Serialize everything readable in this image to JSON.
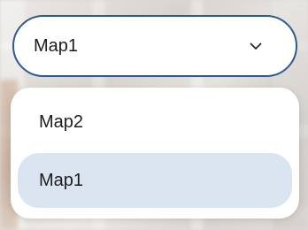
{
  "dropdown": {
    "selected_value": "Map1",
    "expanded": true,
    "options": [
      {
        "label": "Map2",
        "selected": false
      },
      {
        "label": "Map1",
        "selected": true
      }
    ]
  },
  "icons": {
    "toggle": "chevron-down-icon"
  },
  "colors": {
    "border": "#2f5a8c",
    "selected_option_bg": "#dbe5f1",
    "text": "#1c1c1c",
    "surface": "#ffffff"
  }
}
